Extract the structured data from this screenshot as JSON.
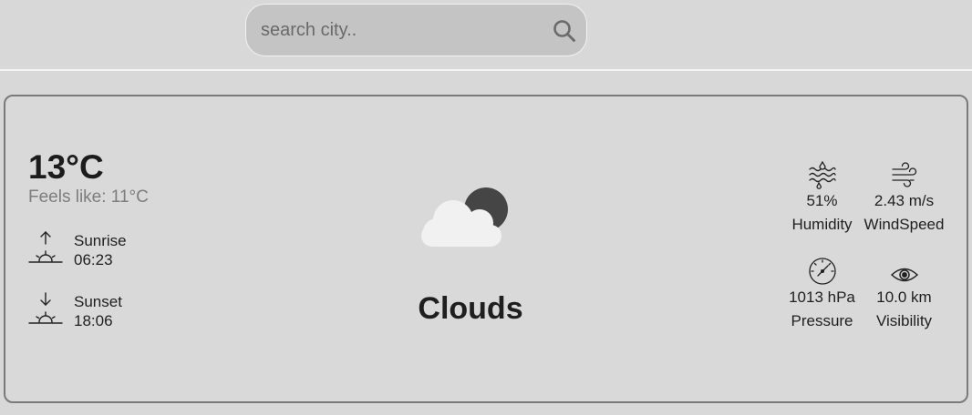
{
  "search": {
    "placeholder": "search city..",
    "icon": "search-icon"
  },
  "weather": {
    "temperature": "13°C",
    "feels_like": "Feels like: 11°C",
    "condition": "Clouds",
    "condition_icon": "clouds-icon",
    "sunrise": {
      "label": "Sunrise",
      "time": "06:23"
    },
    "sunset": {
      "label": "Sunset",
      "time": "18:06"
    }
  },
  "stats": {
    "humidity": {
      "value": "51%",
      "label": "Humidity"
    },
    "wind": {
      "value": "2.43 m/s",
      "label": "WindSpeed"
    },
    "pressure": {
      "value": "1013 hPa",
      "label": "Pressure"
    },
    "visibility": {
      "value": "10.0 km",
      "label": "Visibility"
    }
  },
  "colors": {
    "background": "#d8d8d8",
    "search_bg": "#c4c4c4",
    "card_border": "#7a7a7a",
    "muted_text": "#7d7d7d"
  }
}
